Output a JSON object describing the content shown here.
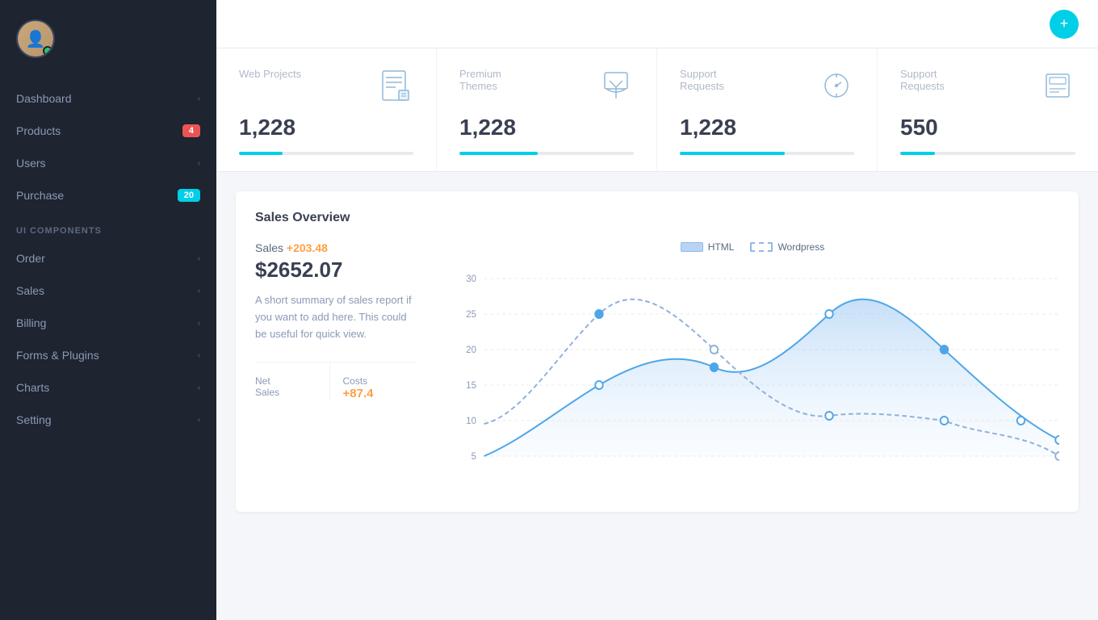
{
  "sidebar": {
    "nav_items": [
      {
        "id": "dashboard",
        "label": "Dashboard",
        "chevron": true,
        "badge": null
      },
      {
        "id": "products",
        "label": "Products",
        "chevron": false,
        "badge": {
          "value": "4",
          "type": "red"
        }
      },
      {
        "id": "users",
        "label": "Users",
        "chevron": true,
        "badge": null
      },
      {
        "id": "purchase",
        "label": "Purchase",
        "chevron": false,
        "badge": {
          "value": "20",
          "type": "blue"
        }
      }
    ],
    "section_title": "UI COMPONENTS",
    "ui_items": [
      {
        "id": "order",
        "label": "Order",
        "chevron": true
      },
      {
        "id": "sales",
        "label": "Sales",
        "chevron": true
      },
      {
        "id": "billing",
        "label": "Billing",
        "chevron": true
      },
      {
        "id": "forms",
        "label": "Forms & Plugins",
        "chevron": true
      },
      {
        "id": "charts",
        "label": "Charts",
        "chevron": true
      },
      {
        "id": "setting",
        "label": "Setting",
        "chevron": true
      }
    ]
  },
  "stats": [
    {
      "id": "web-projects",
      "title": "Web Projects",
      "value": "1,228",
      "bar_percent": 25
    },
    {
      "id": "premium-themes",
      "title": "Premium Themes",
      "value": "1,228",
      "bar_percent": 45
    },
    {
      "id": "support-requests-1",
      "title": "Support Requests",
      "value": "1,228",
      "bar_percent": 60
    },
    {
      "id": "support-requests-2",
      "title": "Support Requests",
      "value": "550",
      "bar_percent": 20
    }
  ],
  "sales": {
    "section_title": "Sales Overview",
    "label": "Sales",
    "change": "+203.48",
    "amount": "$2652.07",
    "description": "A short summary of sales report if you want to add here. This could be useful for quick view.",
    "metrics": [
      {
        "id": "net-sales",
        "title": "Net Sales",
        "value": ""
      },
      {
        "id": "costs",
        "title": "Costs",
        "value": "+87.4",
        "color": "orange"
      }
    ],
    "legend": [
      {
        "id": "html",
        "label": "HTML",
        "type": "solid"
      },
      {
        "id": "wordpress",
        "label": "Wordpress",
        "type": "dashed"
      }
    ],
    "chart_y": [
      "30",
      "25",
      "20",
      "15",
      "10",
      "5"
    ],
    "chart_x": [
      "",
      "",
      "",
      "",
      "",
      "",
      "",
      "",
      "",
      ""
    ]
  }
}
